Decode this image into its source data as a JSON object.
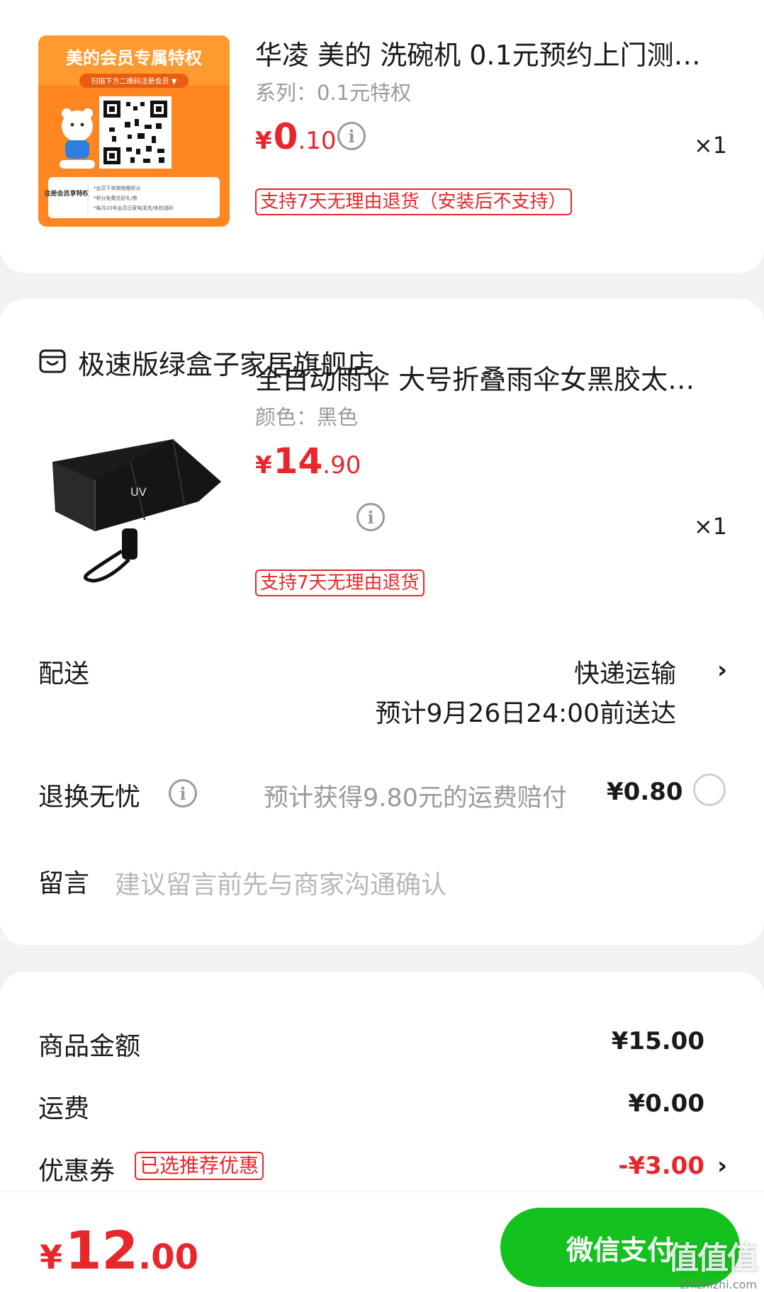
{
  "item1": {
    "promo_image": {
      "title": "美的会员专属特权",
      "subtitle": "扫描下方二维码注册会员 ▼",
      "benefit_label": "注册会员享特权",
      "benefits": [
        "*会员下单购物赠积分",
        "*积分免费兑好礼/券",
        "*每月20号会员日家电清洗/体检福利"
      ]
    },
    "title": "华凌 美的 洗碗机 0.1元预约上门测…",
    "spec": "系列：0.1元特权",
    "price_yen": "¥",
    "price_int": "0",
    "price_dec": ".10",
    "qty": "×1",
    "tag": "支持7天无理由退货（安装后不支持）"
  },
  "store": {
    "name": "极速版绿盒子家居旗舰店",
    "icon": "store-icon"
  },
  "item2": {
    "image_text": "UV",
    "title": "全自动雨伞 大号折叠雨伞女黑胶太…",
    "spec": "颜色：黑色",
    "price_yen": "¥",
    "price_int": "14",
    "price_dec": ".90",
    "qty": "×1",
    "tag": "支持7天无理由退货"
  },
  "delivery": {
    "label": "配送",
    "method": "快递运输",
    "eta": "预计9月26日24:00前送达"
  },
  "return_insurance": {
    "label": "退换无忧",
    "desc": "预计获得9.80元的运费赔付",
    "price": "¥0.80",
    "selected": false
  },
  "message": {
    "label": "留言",
    "placeholder": "建议留言前先与商家沟通确认"
  },
  "summary": {
    "goods_label": "商品金额",
    "goods_value": "¥15.00",
    "shipping_label": "运费",
    "shipping_value": "¥0.00",
    "coupon_label": "优惠券",
    "coupon_tag": "已选推荐优惠",
    "coupon_value": "-¥3.00"
  },
  "footer": {
    "total_yen": "¥",
    "total_int": "12",
    "total_dec": ".00",
    "pay_label": "微信支付"
  },
  "watermark": {
    "brand": "值值值",
    "url": "zhizhizhi.com"
  },
  "colors": {
    "price_red": "#e8262c",
    "pay_green": "#13c11f",
    "promo_orange": "#ff7a1a"
  }
}
